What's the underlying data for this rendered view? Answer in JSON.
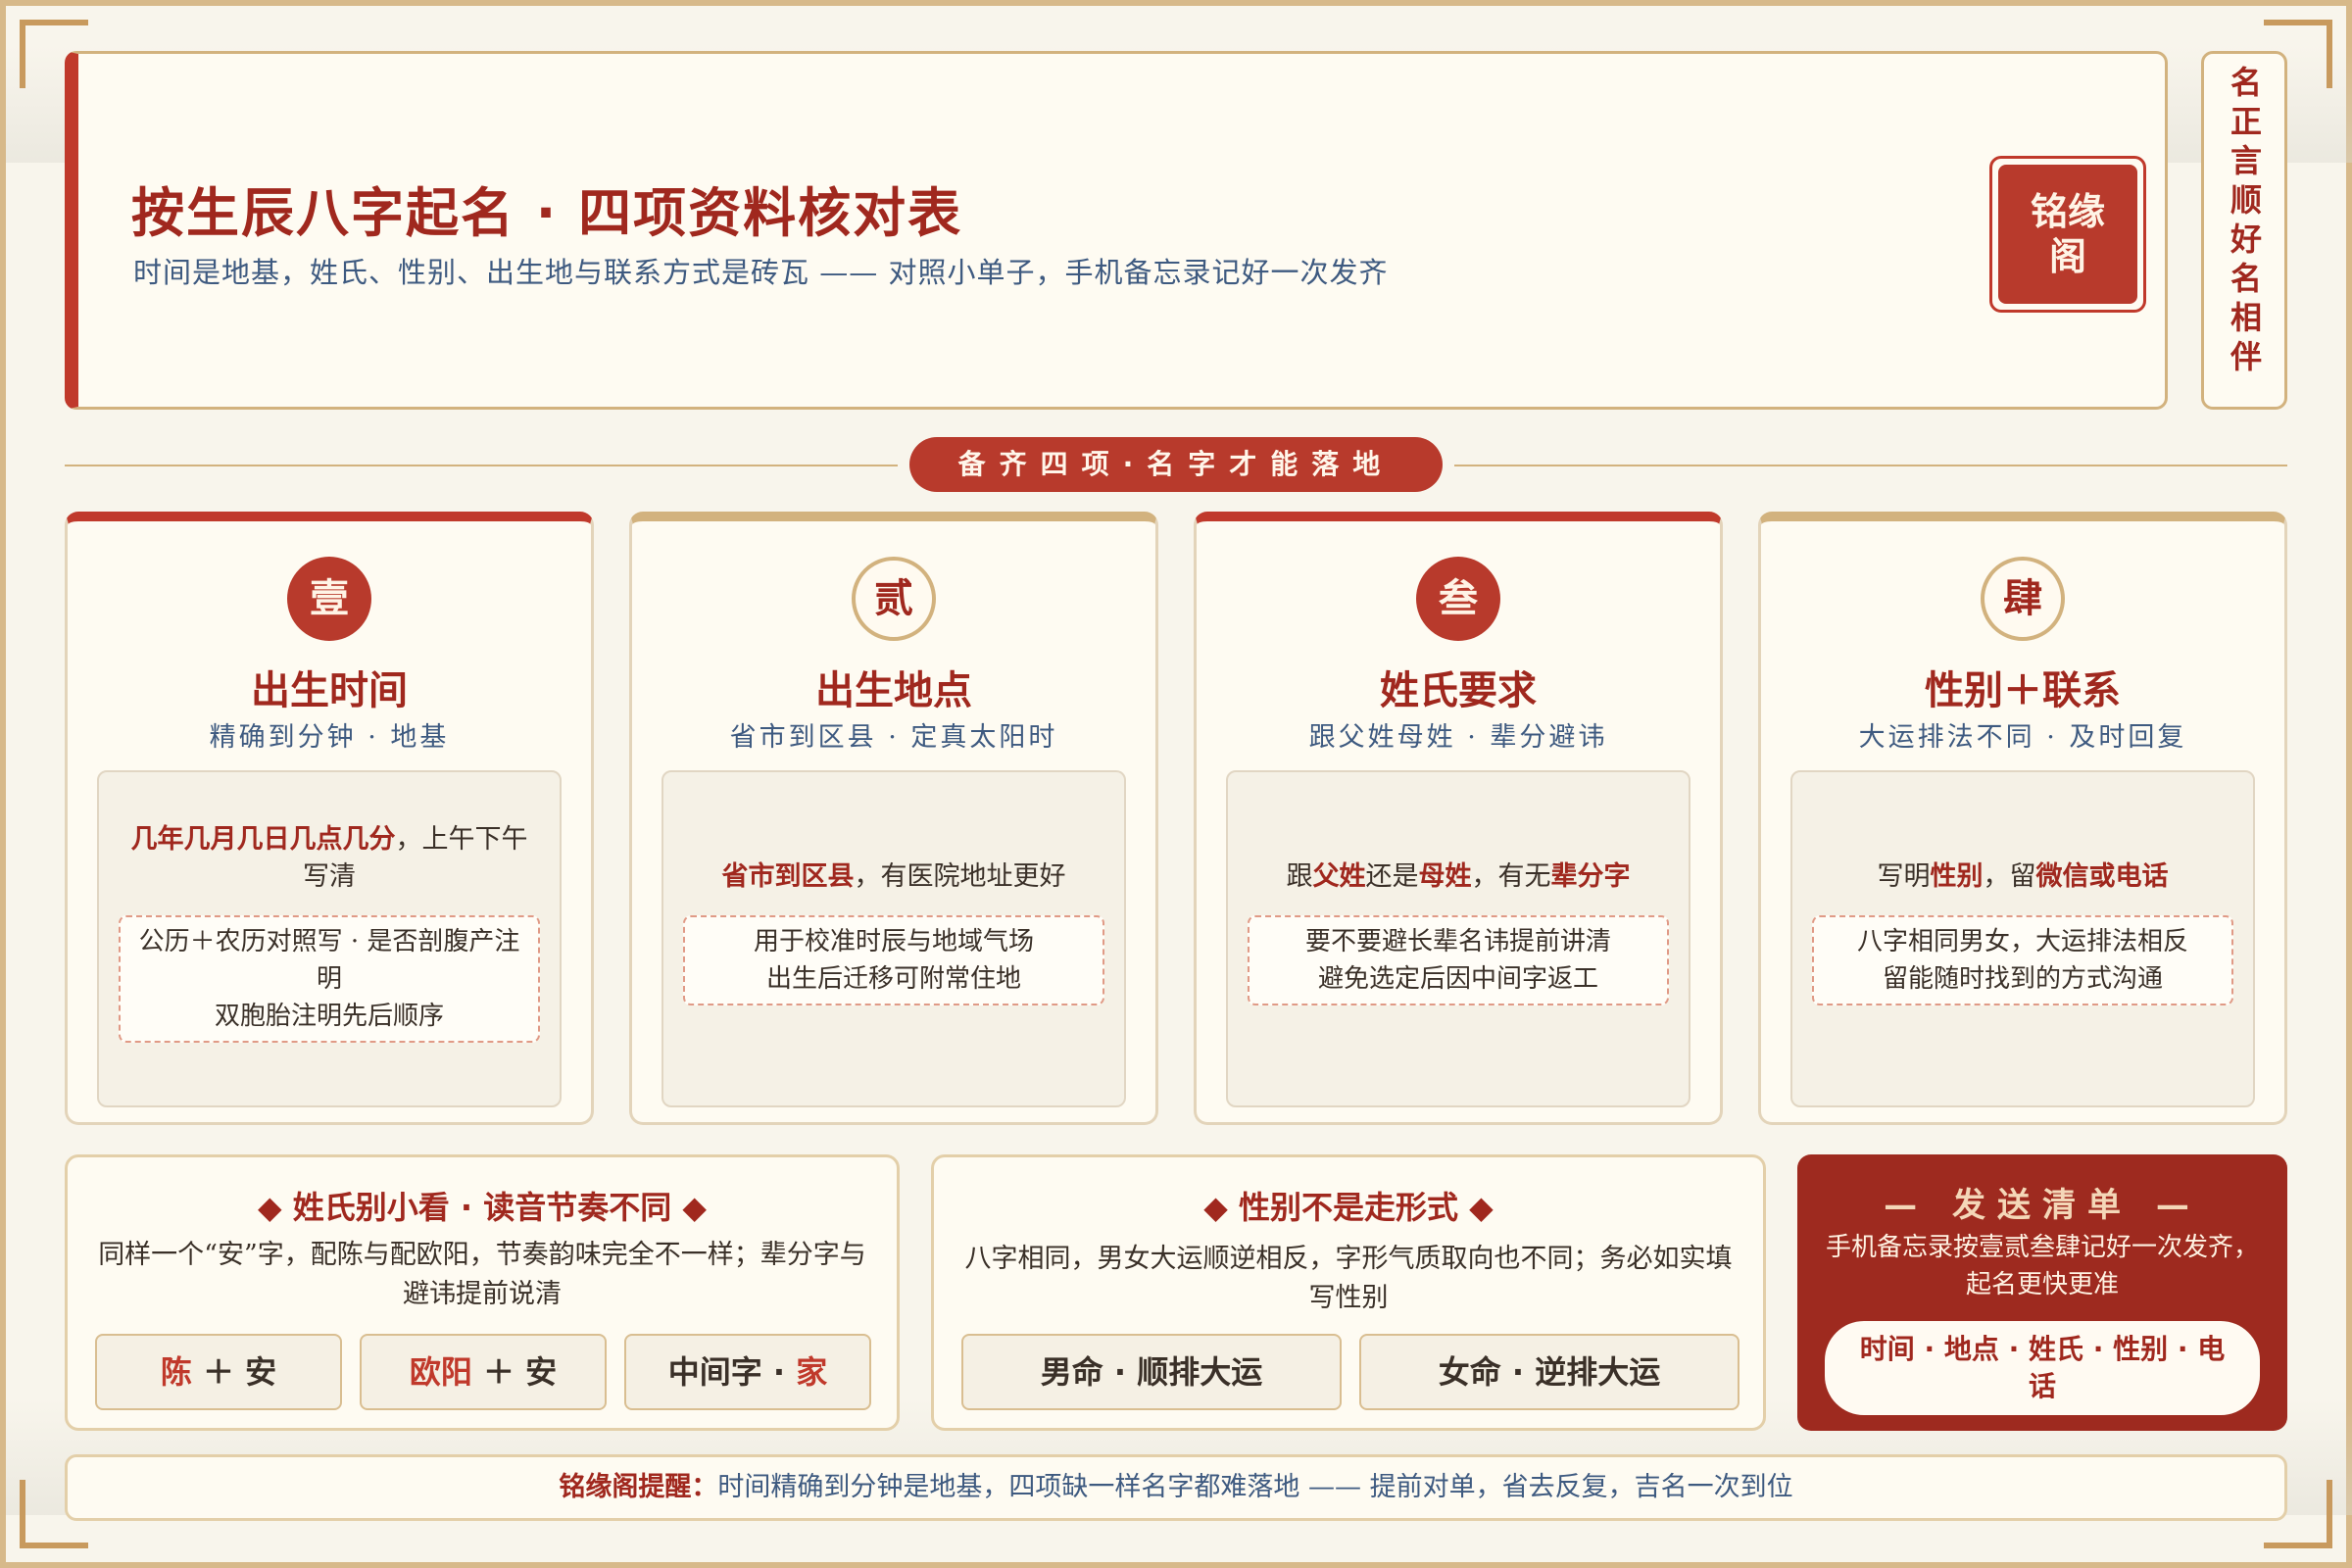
{
  "header": {
    "title": "按生辰八字起名 · 四项资料核对表",
    "subtitle": "时间是地基，姓氏、性别、出生地与联系方式是砖瓦 —— 对照小单子，手机备忘录记好一次发齐",
    "seal": "铭缘阁",
    "side_motto": "名正言顺好名相伴"
  },
  "banner": "备齐四项·名字才能落地",
  "cards": [
    {
      "num": "壹",
      "title": "出生时间",
      "sub": "精确到分钟 · 地基",
      "lead_bold": "几年几月几日几点几分",
      "lead_rest": "，上午下午写清",
      "notes": [
        "公历＋农历对照写 · 是否剖腹产注明",
        "双胞胎注明先后顺序"
      ]
    },
    {
      "num": "贰",
      "title": "出生地点",
      "sub": "省市到区县 · 定真太阳时",
      "lead_bold": "省市到区县",
      "lead_rest": "，有医院地址更好",
      "notes": [
        "用于校准时辰与地域气场",
        "出生后迁移可附常住地"
      ]
    },
    {
      "num": "叁",
      "title": "姓氏要求",
      "sub": "跟父姓母姓 · 辈分避讳",
      "lead_parts": [
        "跟",
        "父姓",
        "还是",
        "母姓",
        "，有无",
        "辈分字"
      ],
      "notes": [
        "要不要避长辈名讳提前讲清",
        "避免选定后因中间字返工"
      ]
    },
    {
      "num": "肆",
      "title": "性别＋联系",
      "sub": "大运排法不同 · 及时回复",
      "lead_parts": [
        "写明",
        "性别",
        "，留",
        "微信或电话"
      ],
      "notes": [
        "八字相同男女，大运排法相反",
        "留能随时找到的方式沟通"
      ]
    }
  ],
  "panel_surname": {
    "title": "◆ 姓氏别小看 · 读音节奏不同 ◆",
    "text": "同样一个“安”字，配陈与配欧阳，节奏韵味完全不一样；辈分字与避讳提前说清",
    "chips": [
      {
        "a": "陈",
        "b": " ＋ 安"
      },
      {
        "a": "欧阳",
        "b": " ＋ 安"
      },
      {
        "a": "中间字 · ",
        "b": "家"
      }
    ]
  },
  "panel_gender": {
    "title": "◆ 性别不是走形式 ◆",
    "text": "八字相同，男女大运顺逆相反，字形气质取向也不同；务必如实填写性别",
    "chips": [
      "男命 · 顺排大运",
      "女命 · 逆排大运"
    ]
  },
  "panel_send": {
    "title": "— 发送清单 —",
    "text": "手机备忘录按壹贰叁肆记好一次发齐，起名更快更准",
    "pill": "时间 · 地点 · 姓氏 · 性别 · 电话"
  },
  "footer": {
    "label": "铭缘阁提醒：",
    "text": "时间精确到分钟是地基，四项缺一样名字都难落地 —— 提前对单，省去反复，吉名一次到位"
  },
  "colors": {
    "accent": "#b83a2c",
    "gold": "#d2b27e",
    "navy": "#3e5a80",
    "bg": "#f8f5ec"
  }
}
